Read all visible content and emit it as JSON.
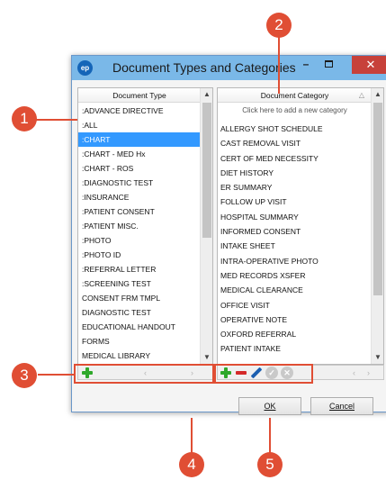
{
  "window": {
    "title": "Document Types and Categories",
    "app_icon_text": "ep"
  },
  "document_type_panel": {
    "header": "Document Type",
    "items": [
      ":ADVANCE DIRECTIVE",
      ":ALL",
      ":CHART",
      ":CHART - MED Hx",
      ":CHART - ROS",
      ":DIAGNOSTIC TEST",
      ":INSURANCE",
      ":PATIENT CONSENT",
      ":PATIENT MISC.",
      ":PHOTO",
      ":PHOTO ID",
      ":REFERRAL LETTER",
      ":SCREENING TEST",
      "CONSENT FRM TMPL",
      "DIAGNOSTIC TEST",
      "EDUCATIONAL HANDOUT",
      "FORMS",
      "MEDICAL LIBRARY"
    ],
    "selected_item": ":CHART"
  },
  "document_category_panel": {
    "header": "Document Category",
    "new_category_placeholder": "Click here to add a new category",
    "items": [
      "ALLERGY SHOT SCHEDULE",
      "CAST REMOVAL VISIT",
      "CERT OF MED NECESSITY",
      "DIET HISTORY",
      "ER SUMMARY",
      "FOLLOW UP VISIT",
      "HOSPITAL SUMMARY",
      "INFORMED CONSENT",
      "INTAKE SHEET",
      "INTRA-OPERATIVE PHOTO",
      "MED RECORDS XSFER",
      "MEDICAL CLEARANCE",
      "OFFICE VISIT",
      "OPERATIVE NOTE",
      "OXFORD REFERRAL",
      "PATIENT INTAKE"
    ]
  },
  "buttons": {
    "ok": "OK",
    "cancel": "Cancel"
  },
  "callouts": [
    "1",
    "2",
    "3",
    "4",
    "5"
  ],
  "colors": {
    "callout": "#e04e34",
    "selection": "#3399ff",
    "titlebar": "#7ab8e8"
  }
}
